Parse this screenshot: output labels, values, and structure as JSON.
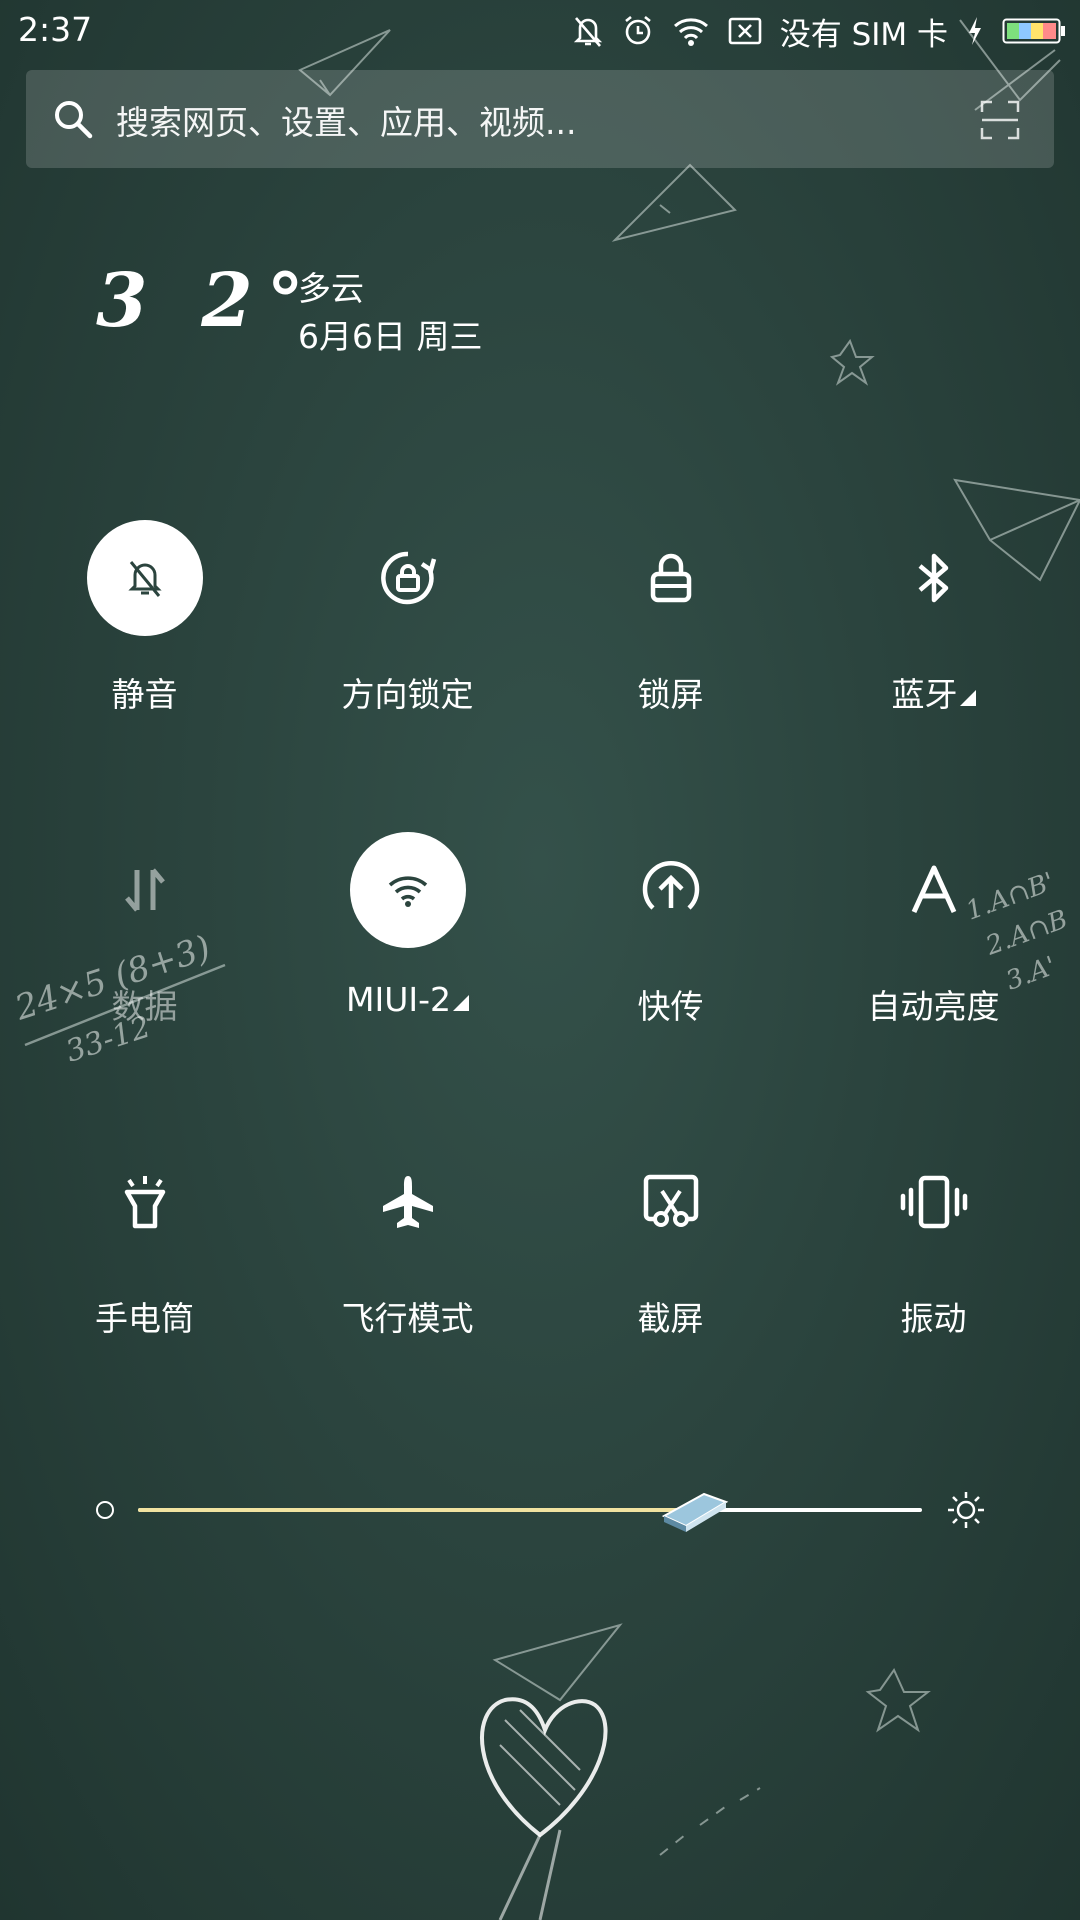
{
  "status_bar": {
    "time": "2:37",
    "carrier": "没有 SIM 卡",
    "icons": [
      "mute-icon",
      "alarm-icon",
      "wifi-icon",
      "sim-missing-icon",
      "charging-icon",
      "battery-icon"
    ]
  },
  "search": {
    "placeholder": "搜索网页、设置、应用、视频..."
  },
  "weather": {
    "temperature": "3 2°",
    "condition": "多云",
    "date": "6月6日 周三"
  },
  "toggles": [
    {
      "label": "静音",
      "icon": "mute-icon",
      "active": true
    },
    {
      "label": "方向锁定",
      "icon": "rotation-lock-icon",
      "active": false
    },
    {
      "label": "锁屏",
      "icon": "lock-icon",
      "active": false
    },
    {
      "label": "蓝牙",
      "icon": "bluetooth-icon",
      "active": false,
      "has_menu": true
    },
    {
      "label": "数据",
      "icon": "mobile-data-icon",
      "active": false,
      "disabled": true
    },
    {
      "label": "MIUI-2",
      "icon": "wifi-icon",
      "active": true,
      "has_menu": true
    },
    {
      "label": "快传",
      "icon": "quick-share-icon",
      "active": false
    },
    {
      "label": "自动亮度",
      "icon": "auto-brightness-icon",
      "active": false
    },
    {
      "label": "手电筒",
      "icon": "flashlight-icon",
      "active": false
    },
    {
      "label": "飞行模式",
      "icon": "airplane-icon",
      "active": false
    },
    {
      "label": "截屏",
      "icon": "screenshot-icon",
      "active": false
    },
    {
      "label": "振动",
      "icon": "vibrate-icon",
      "active": false
    }
  ],
  "brightness": {
    "level": 0.71
  },
  "colors": {
    "background": "#2b443e",
    "accent_fill": "#f1e3a1",
    "tile_active": "#ffffff"
  }
}
